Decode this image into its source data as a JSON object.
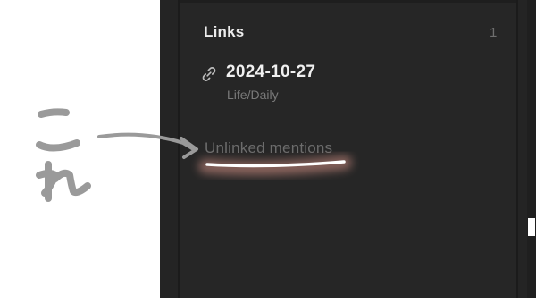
{
  "panel": {
    "links_heading": "Links",
    "links_count": "1",
    "links": [
      {
        "title": "2024-10-27",
        "path": "Life/Daily",
        "icon": "link-icon"
      }
    ],
    "unlinked_mentions_label": "Unlinked mentions"
  },
  "annotation": {
    "handwritten_text": "これ",
    "arrow": "arrow-icon",
    "highlight_color": "#e0a8a0",
    "stroke_color": "#9a9a9a"
  },
  "colors": {
    "panel_bg": "#242424",
    "heading_text": "#ececec",
    "muted_text": "#6c6c6c"
  }
}
